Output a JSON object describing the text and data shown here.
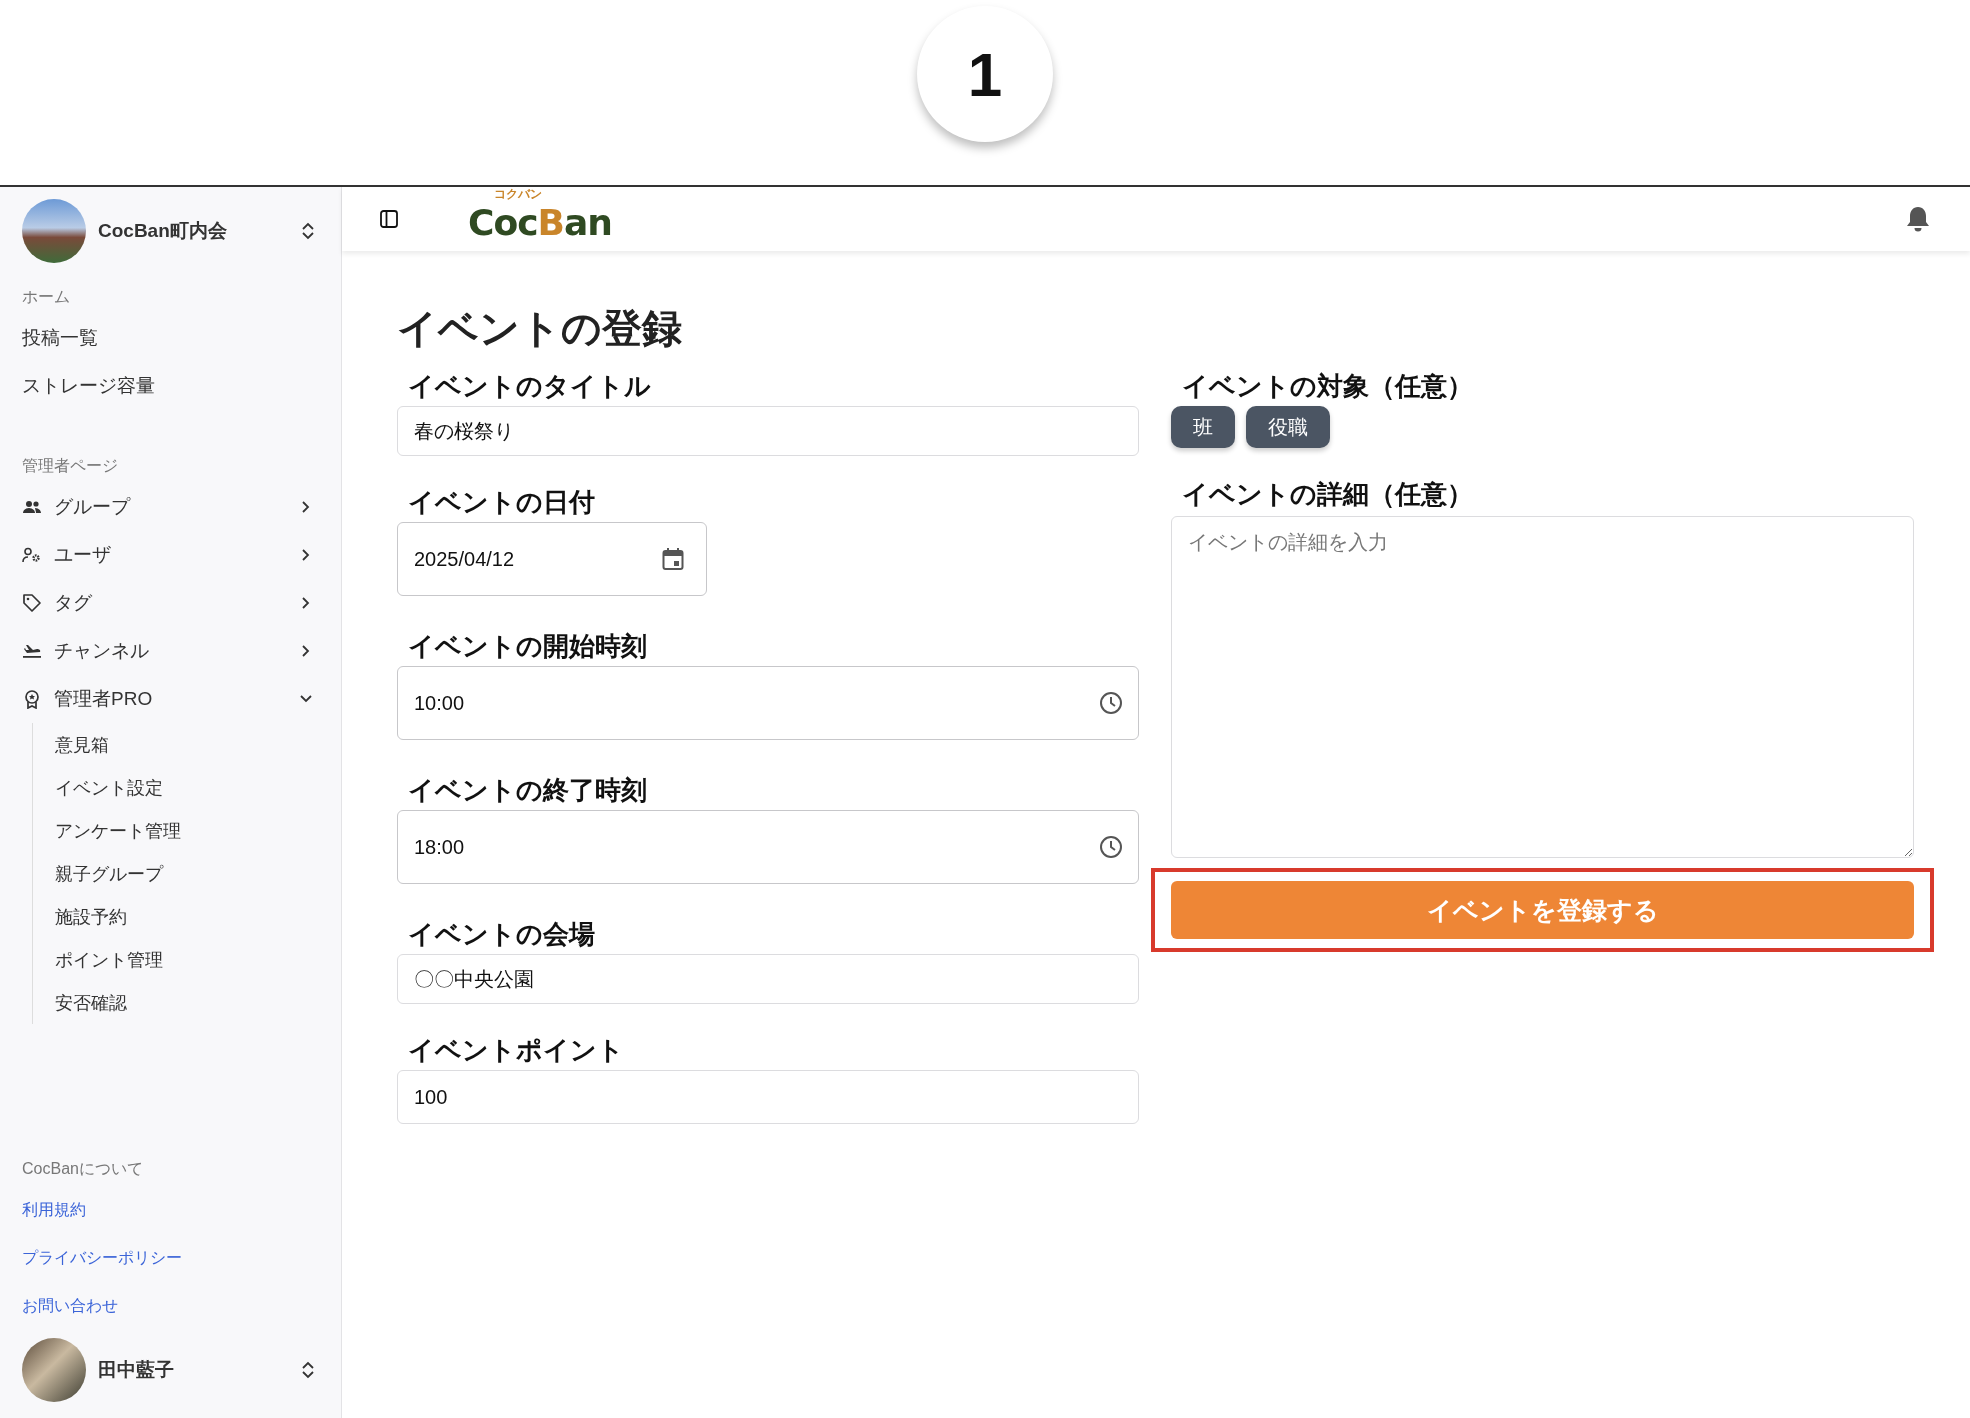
{
  "step_badge": "1",
  "sidebar": {
    "org": {
      "name": "CocBan町内会"
    },
    "home": {
      "heading": "ホーム",
      "items": [
        {
          "label": "投稿一覧"
        },
        {
          "label": "ストレージ容量"
        }
      ]
    },
    "admin": {
      "heading": "管理者ページ",
      "items": [
        {
          "label": "グループ",
          "kind": "people",
          "expanded": false
        },
        {
          "label": "ユーザ",
          "kind": "usergear",
          "expanded": false
        },
        {
          "label": "タグ",
          "kind": "tag",
          "expanded": false
        },
        {
          "label": "チャンネル",
          "kind": "plane",
          "expanded": false
        },
        {
          "label": "管理者PRO",
          "kind": "award",
          "expanded": true,
          "children": [
            {
              "label": "意見箱"
            },
            {
              "label": "イベント設定"
            },
            {
              "label": "アンケート管理"
            },
            {
              "label": "親子グループ"
            },
            {
              "label": "施設予約"
            },
            {
              "label": "ポイント管理"
            },
            {
              "label": "安否確認"
            }
          ]
        }
      ]
    },
    "about": {
      "heading": "CocBanについて",
      "links": [
        "利用規約",
        "プライバシーポリシー",
        "お問い合わせ"
      ]
    },
    "user": {
      "name": "田中藍子"
    }
  },
  "header": {
    "logo": {
      "ruby": "コクバン",
      "parts": [
        {
          "text": "Coc",
          "highlight": false
        },
        {
          "text": "B",
          "highlight": true
        },
        {
          "text": "an",
          "highlight": false
        }
      ]
    }
  },
  "page": {
    "title": "イベントの登録",
    "fields": [
      {
        "label": "イベントのタイトル",
        "kind": "text",
        "value": "春の桜祭り"
      },
      {
        "label": "イベントの日付",
        "kind": "date",
        "value": "2025/04/12"
      },
      {
        "label": "イベントの開始時刻",
        "kind": "time",
        "value": "10:00"
      },
      {
        "label": "イベントの終了時刻",
        "kind": "time",
        "value": "18:00"
      },
      {
        "label": "イベントの会場",
        "kind": "text",
        "value": "〇〇中央公園"
      },
      {
        "label": "イベントポイント",
        "kind": "text",
        "value": "100"
      }
    ],
    "target": {
      "label": "イベントの対象（任意）",
      "chips": [
        "班",
        "役職"
      ]
    },
    "details": {
      "label": "イベントの詳細（任意）",
      "placeholder": "イベントの詳細を入力"
    },
    "submit": {
      "label": "イベントを登録する",
      "highlighted": true
    }
  }
}
